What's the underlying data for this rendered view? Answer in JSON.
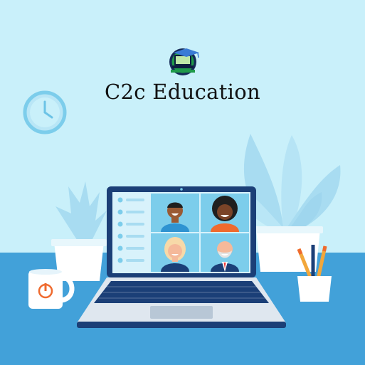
{
  "brand": {
    "name": "C2c Education",
    "logo_icon": "laptop-graduation-cap-icon"
  },
  "scene": {
    "clock_icon": "wall-clock-icon",
    "laptop_icon": "laptop-icon",
    "mug_icon": "power-mug-icon",
    "participants": [
      {
        "name": "participant-1"
      },
      {
        "name": "participant-2"
      },
      {
        "name": "participant-3"
      },
      {
        "name": "participant-4"
      }
    ]
  },
  "colors": {
    "background": "#c9f0fa",
    "table": "#42a1d9",
    "accent": "#1b3f77",
    "plant": "#a8dcf1",
    "mug_power": "#ef6a2e"
  }
}
